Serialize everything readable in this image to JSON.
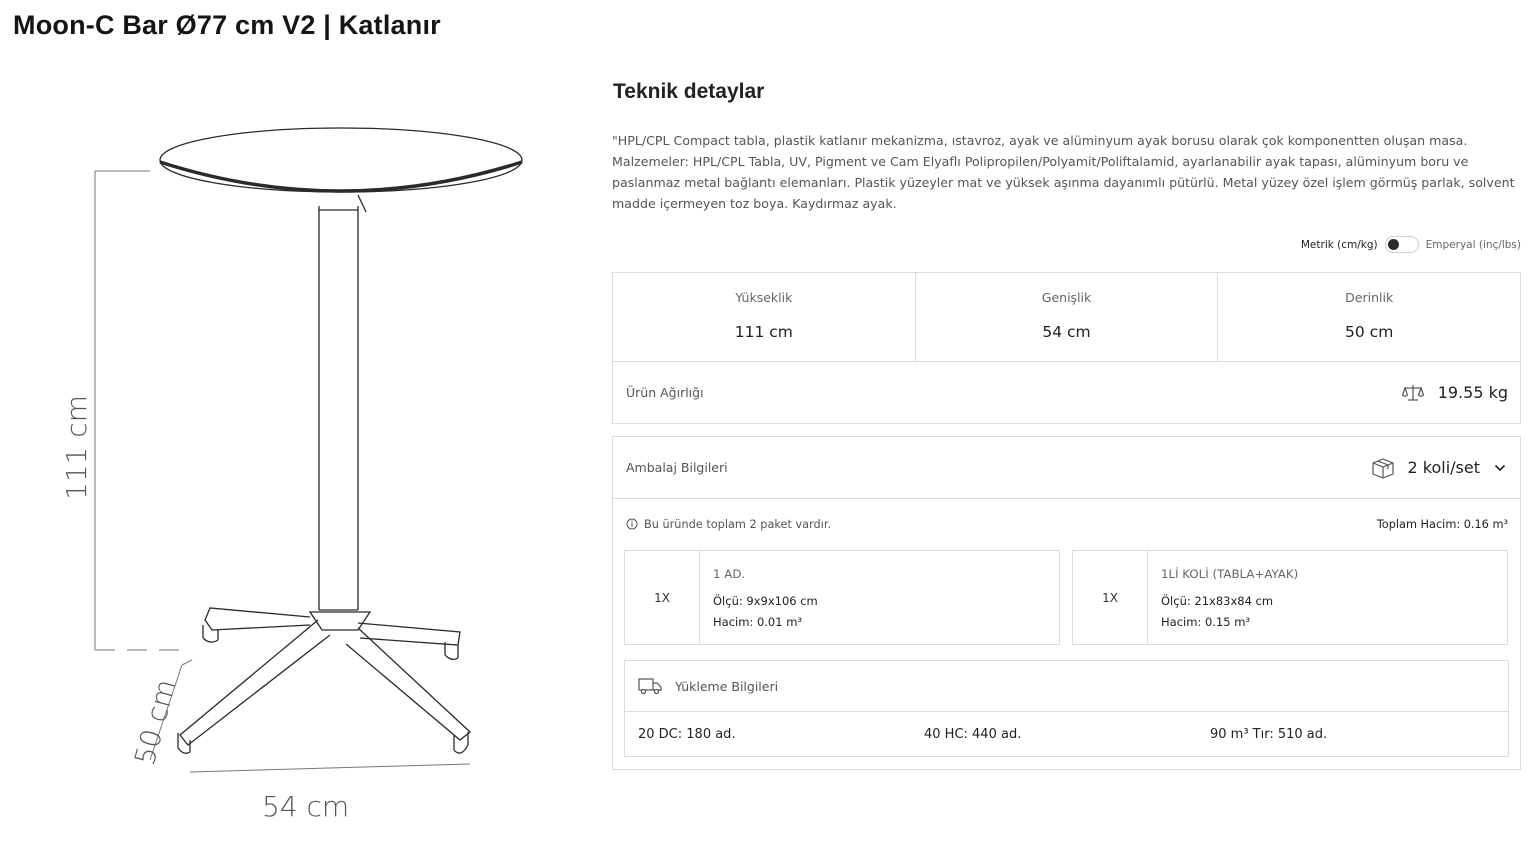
{
  "product": {
    "title": "Moon-C Bar Ø77 cm V2 | Katlanır"
  },
  "drawing": {
    "height_label": "111 cm",
    "depth_label": "50 cm",
    "width_label": "54 cm"
  },
  "details": {
    "title": "Teknik detaylar",
    "description": "\"HPL/CPL Compact tabla, plastik katlanır mekanizma, ıstavroz, ayak ve alüminyum ayak borusu olarak çok komponentten oluşan masa. Malzemeler: HPL/CPL Tabla, UV, Pigment ve Cam Elyaflı Polipropilen/Polyamit/Poliftalamid, ayarlanabilir ayak tapası, alüminyum boru ve paslanmaz metal bağlantı elemanları. Plastik yüzeyler mat ve yüksek aşınma dayanımlı pütürlü. Metal yüzey özel işlem görmüş parlak, solvent madde içermeyen toz boya. Kaydırmaz ayak."
  },
  "unit_toggle": {
    "left_label": "Metrik (cm/kg)",
    "right_label": "Emperyal (inç/lbs)",
    "selected": "Metrik (cm/kg)"
  },
  "dimensions": [
    {
      "label": "Yükseklik",
      "value": "111 cm"
    },
    {
      "label": "Genişlik",
      "value": "54 cm"
    },
    {
      "label": "Derinlik",
      "value": "50 cm"
    }
  ],
  "weight": {
    "label": "Ürün Ağırlığı",
    "value": "19.55 kg",
    "icon": "scale-icon"
  },
  "packaging": {
    "label": "Ambalaj Bilgileri",
    "value": "2 koli/set",
    "icon": "box-icon",
    "info_text": "Bu üründe toplam 2 paket vardır.",
    "total_volume": "Toplam Hacim: 0.16 m³",
    "packages": [
      {
        "qty": "1X",
        "name": "1 AD.",
        "size": "Ölçü: 9x9x106 cm",
        "volume": "Hacim: 0.01 m³"
      },
      {
        "qty": "1X",
        "name": "1Lİ KOLİ (TABLA+AYAK)",
        "size": "Ölçü: 21x83x84 cm",
        "volume": "Hacim: 0.15 m³"
      }
    ]
  },
  "loading": {
    "label": "Yükleme Bilgileri",
    "icon": "truck-icon",
    "items": [
      "20 DC: 180 ad.",
      "40 HC: 440 ad.",
      "90 m³ Tır: 510 ad."
    ]
  }
}
